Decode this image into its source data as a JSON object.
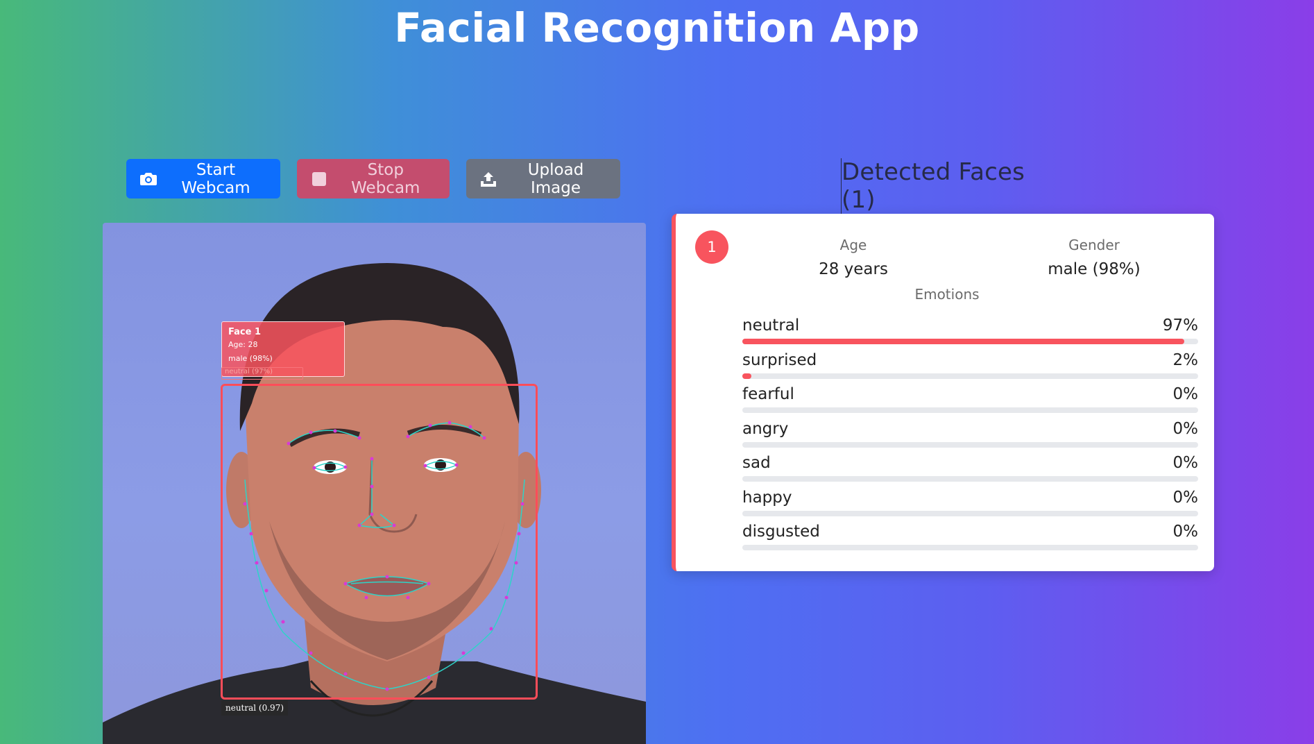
{
  "app": {
    "title": "Facial Recognition App"
  },
  "toolbar": {
    "start_label": "Start Webcam",
    "stop_label": "Stop Webcam",
    "upload_label": "Upload Image",
    "start_icon": "camera-icon",
    "stop_icon": "stop-square-icon",
    "upload_icon": "upload-icon"
  },
  "video": {
    "overlay": {
      "title": "Face 1",
      "age": "Age: 28",
      "gender": "male (98%)",
      "emotion": "neutral (97%)"
    },
    "detection_tag": "neutral (0.97)"
  },
  "results": {
    "title": "Detected Faces (1)",
    "faces": [
      {
        "index": "1",
        "age_label": "Age",
        "age_value": "28 years",
        "gender_label": "Gender",
        "gender_value": "male (98%)",
        "emotions_title": "Emotions",
        "emotions": [
          {
            "name": "neutral",
            "percent": "97%",
            "value": 0.97
          },
          {
            "name": "surprised",
            "percent": "2%",
            "value": 0.02
          },
          {
            "name": "fearful",
            "percent": "0%",
            "value": 0.0
          },
          {
            "name": "angry",
            "percent": "0%",
            "value": 0.0
          },
          {
            "name": "sad",
            "percent": "0%",
            "value": 0.0
          },
          {
            "name": "happy",
            "percent": "0%",
            "value": 0.0
          },
          {
            "name": "disgusted",
            "percent": "0%",
            "value": 0.0
          }
        ]
      }
    ]
  },
  "colors": {
    "accent": "#f8545e",
    "primary_button": "#0d6efd",
    "stop_button": "#c44d6e",
    "upload_button": "#6b7280"
  }
}
